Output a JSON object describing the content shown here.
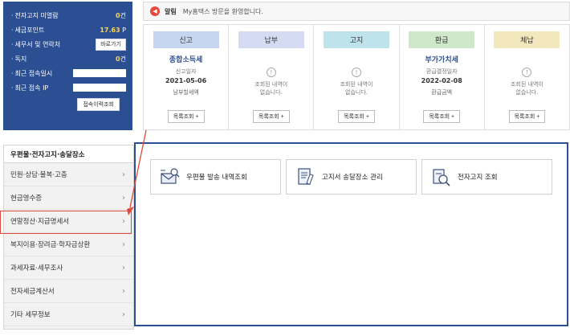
{
  "user_panel": {
    "rows": [
      {
        "label": "전자고지 미열람",
        "value_num": "0",
        "value_unit": "건"
      },
      {
        "label": "세금포인트",
        "value_num": "17.63",
        "value_unit": "P"
      },
      {
        "label": "세무서 및 연락처",
        "button": "바로가기"
      },
      {
        "label": "독지",
        "value_num": "0",
        "value_unit": "건"
      },
      {
        "label": "최근 접속일시"
      },
      {
        "label": "최근 접속 IP"
      }
    ],
    "login_history_button": "접속이력조회"
  },
  "notice": {
    "title": "알림",
    "text": "My홈택스 방문을 환영합니다."
  },
  "cards": [
    {
      "badge": "신고",
      "badge_color": "#c7d6f0",
      "title": "종합소득세",
      "sub": "신고일자",
      "date": "2021-05-06",
      "foot": "남부할세액",
      "button": "목록조회 +"
    },
    {
      "badge": "납부",
      "badge_color": "#d5dbf2",
      "empty": "조회된 내역이\n없습니다.",
      "button": "목록조회 +"
    },
    {
      "badge": "고지",
      "badge_color": "#bfe3ea",
      "empty": "조회된 내역이\n없습니다.",
      "button": "목록조회 +"
    },
    {
      "badge": "환급",
      "badge_color": "#cfe8c9",
      "title": "부가가치세",
      "sub": "환급결정일자",
      "date": "2022-02-08",
      "foot": "환급금액",
      "button": "목록조회 +"
    },
    {
      "badge": "체납",
      "badge_color": "#f3e7bd",
      "empty": "조회된 내역이\n없습니다.",
      "button": "목록조회 +"
    }
  ],
  "menu": {
    "header": "우편물·전자고지·송달장소",
    "items": [
      "민원·상담·불복·고충",
      "현금영수증",
      "연말정산·지급명세서",
      "복지이용·장려금·학자금상환",
      "과세자료·세무조사",
      "전자세금계산서",
      "기타 세무정보"
    ]
  },
  "tiles": [
    {
      "label": "우편물 발송 내역조회",
      "icon": "envelope-magnifier-icon"
    },
    {
      "label": "고지서 송달장소 관리",
      "icon": "document-edit-icon"
    },
    {
      "label": "전자고지 조회",
      "icon": "document-search-icon"
    }
  ],
  "colors": {
    "panel_blue": "#2c4f94",
    "highlight_red": "#e04a3a",
    "point_yellow": "#ffd54a"
  }
}
